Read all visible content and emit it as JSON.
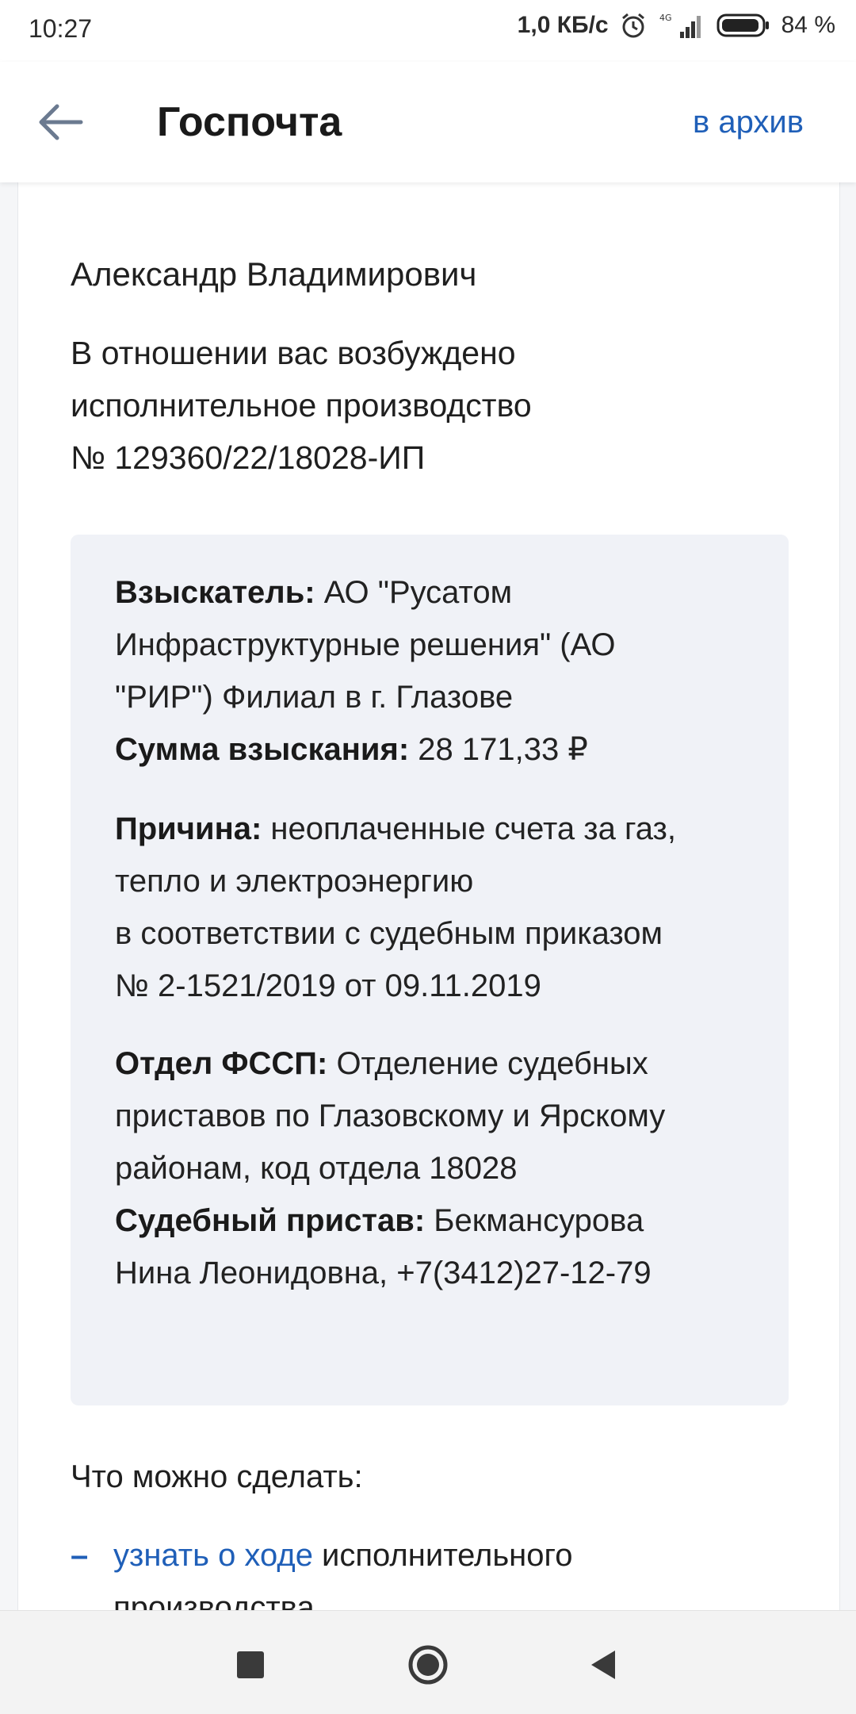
{
  "status_bar": {
    "time": "10:27",
    "network_speed": "1,0 КБ/с",
    "signal_label": "4G",
    "battery": "84 %"
  },
  "app_bar": {
    "title": "Госпочта",
    "archive_label": "в архив"
  },
  "message": {
    "greeting": "Александр Владимирович",
    "intro_line1": "В отношении вас возбуждено",
    "intro_line2": "исполнительное производство",
    "intro_line3": "№ 129360/22/18028-ИП"
  },
  "details": {
    "claimant_label": "Взыскатель:",
    "claimant_value_1": " АО \"Русатом",
    "claimant_value_2": "Инфраструктурные решения\" (АО",
    "claimant_value_3": "\"РИР\") Филиал в г. Глазове",
    "amount_label": "Сумма взыскания:",
    "amount_value": " 28 171,33 ₽",
    "reason_label": "Причина:",
    "reason_value_1": " неоплаченные счета за газ,",
    "reason_value_2": "тепло и электроэнергию",
    "reason_value_3": "в соответствии с судебным приказом",
    "reason_value_4": "№ 2-1521/2019 от 09.11.2019",
    "department_label": "Отдел ФССП:",
    "department_value_1": " Отделение судебных",
    "department_value_2": "приставов по Глазовскому и Ярскому",
    "department_value_3": "районам, код отдела 18028",
    "bailiff_label": "Судебный пристав:",
    "bailiff_value_1": " Бекмансурова",
    "bailiff_value_2": "Нина Леонидовна, +7(3412)27-12-79"
  },
  "actions": {
    "title": "Что можно сделать:",
    "items": [
      {
        "bullet": "–",
        "link": "узнать о ходе",
        "rest_1": " исполнительного",
        "rest_2": "производства"
      }
    ]
  },
  "icons": {
    "back": "arrow-left-icon",
    "nav_recent": "square-icon",
    "nav_home": "circle-icon",
    "nav_back": "triangle-icon"
  },
  "colors": {
    "accent": "#1f5fb8",
    "info_box_bg": "#f0f2f7"
  }
}
